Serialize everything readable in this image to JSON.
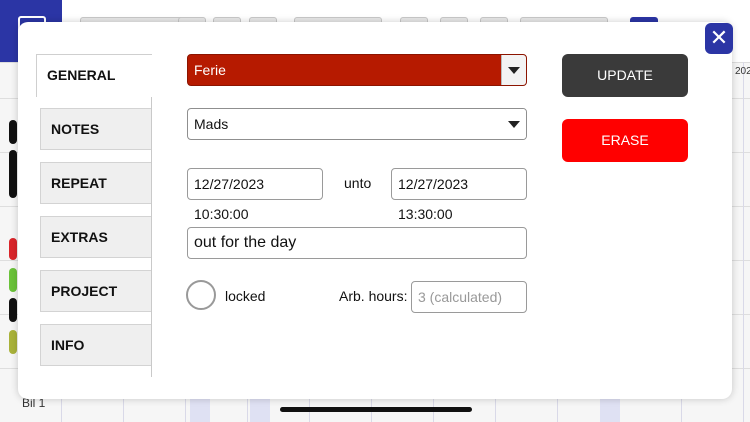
{
  "background": {
    "row_label": "Bil 1",
    "date_stub": "202"
  },
  "dialog": {
    "close_glyph": "✕",
    "tabs": [
      {
        "label": "GENERAL"
      },
      {
        "label": "NOTES"
      },
      {
        "label": "REPEAT"
      },
      {
        "label": "EXTRAS"
      },
      {
        "label": "PROJECT"
      },
      {
        "label": "INFO"
      }
    ],
    "type_select": {
      "value": "Ferie",
      "color": "#b61a00"
    },
    "person_select": {
      "value": "Mads"
    },
    "start_field": {
      "value": "12/27/2023 10:30:00"
    },
    "unto_label": "unto",
    "end_field": {
      "value": "12/27/2023 13:30:00"
    },
    "description_field": {
      "value": "out for the day"
    },
    "locked_label": "locked",
    "arb_hours_label": "Arb. hours:",
    "arb_hours_field": {
      "placeholder": "3 (calculated)"
    },
    "update_button": "UPDATE",
    "erase_button": "ERASE"
  }
}
